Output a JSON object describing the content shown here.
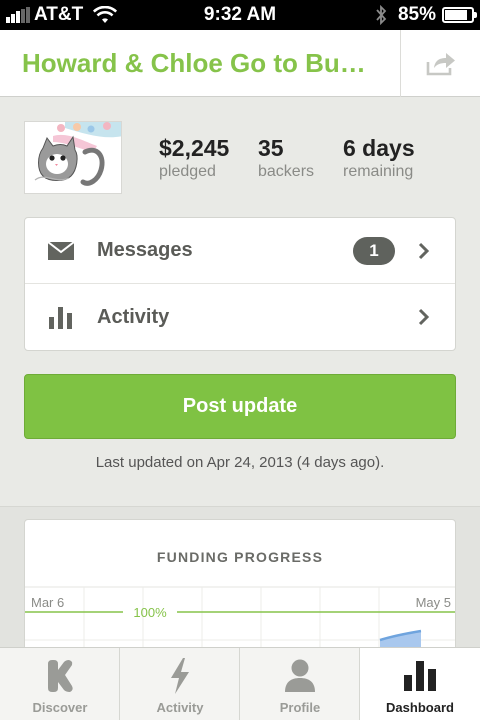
{
  "status_bar": {
    "carrier": "AT&T",
    "time": "9:32 AM",
    "battery": "85%",
    "battery_level": 0.85
  },
  "nav": {
    "title": "Howard & Chloe Go to Bu…",
    "share_icon": "share-icon"
  },
  "stats": {
    "pledged_value": "$2,245",
    "pledged_label": "pledged",
    "backers_value": "35",
    "backers_label": "backers",
    "remaining_value": "6 days",
    "remaining_label": "remaining"
  },
  "menu": {
    "messages_label": "Messages",
    "messages_count": "1",
    "activity_label": "Activity"
  },
  "post_update_label": "Post update",
  "last_updated": "Last updated on Apr 24, 2013 (4 days ago).",
  "funding": {
    "title": "FUNDING PROGRESS",
    "start_label": "Mar 6",
    "end_label": "May 5",
    "goal_label": "100%"
  },
  "tabs": [
    {
      "label": "Discover",
      "icon": "kickstarter-k-icon"
    },
    {
      "label": "Activity",
      "icon": "lightning-bolt-icon"
    },
    {
      "label": "Profile",
      "icon": "person-icon"
    },
    {
      "label": "Dashboard",
      "icon": "bar-chart-icon"
    }
  ],
  "colors": {
    "accent_green": "#86c34a",
    "button_green": "#7fc243",
    "chart_blue": "#6fa4de"
  }
}
